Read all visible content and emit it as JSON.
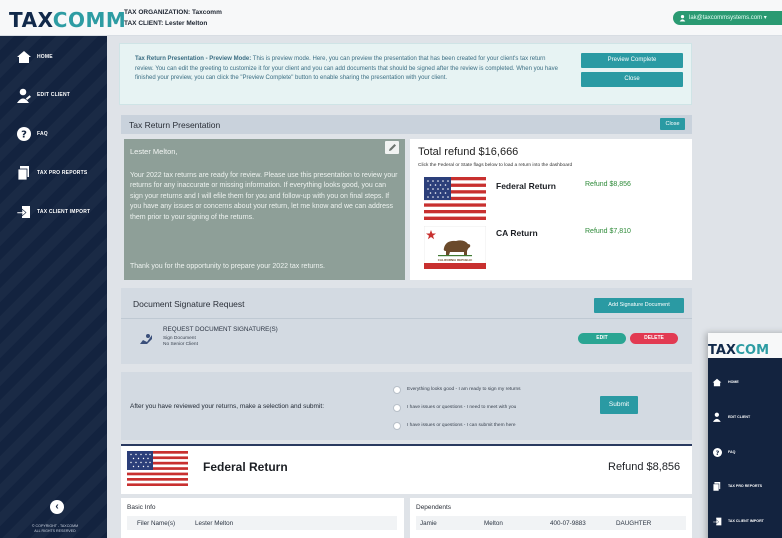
{
  "header": {
    "logo_main": "TAX",
    "logo_accent": "COMM",
    "org_line": "TAX ORGANIZATION: Taxcomm",
    "client_line": "TAX CLIENT: Lester Melton",
    "user_email": "lak@taxcommsystems.com ▾"
  },
  "sidebar": {
    "items": [
      {
        "label": "HOME",
        "icon": "home-icon"
      },
      {
        "label": "EDIT CLIENT",
        "icon": "user-edit-icon"
      },
      {
        "label": "FAQ",
        "icon": "question-icon"
      },
      {
        "label": "TAX PRO REPORTS",
        "icon": "report-icon"
      },
      {
        "label": "TAX CLIENT IMPORT",
        "icon": "import-icon"
      }
    ],
    "copyright_1": "© COPYRIGHT - TAXCOMM",
    "copyright_2": "ALL RIGHTS RESERVED"
  },
  "notice": {
    "bold": "Tax Return Presentation - Preview Mode:",
    "text": " This is preview mode. Here, you can preview the presentation that has been created for your client's tax return review. You can edit the greeting to customize it for your client and you can add documents that should be signed after the review is completed. When you have finished your preview, you can click the \"Preview Complete\" button to enable sharing the presentation with your client.",
    "preview_complete": "Preview Complete",
    "close": "Close"
  },
  "presentation": {
    "title": "Tax Return Presentation",
    "close": "Close"
  },
  "greeting": {
    "name": "Lester Melton,",
    "body": "Your 2022 tax returns are ready for review. Please use this presentation to review your returns for any inaccurate or missing information. If everything looks good, you can sign your returns and I will efile them for you and follow-up with you on final steps. If you have any issues or concerns about your return, let me know and we can address them prior to your signing of the returns.",
    "thanks": "Thank you for the opportunity to prepare your 2022 tax returns."
  },
  "refunds": {
    "total": "Total refund $16,666",
    "hint": "Click the Federal or State flags below to load a return into the dashboard",
    "federal_label": "Federal Return",
    "federal_amount": "Refund $8,856",
    "state_label": "CA Return",
    "state_amount": "Refund $7,810",
    "ca_flag_text": "CALIFORNIA REPUBLIC"
  },
  "documents": {
    "title": "Document Signature Request",
    "add_button": "Add Signature Document",
    "request_title": "REQUEST DOCUMENT SIGNATURE(S)",
    "sub1": "Sign Document",
    "sub2": "No Senior Client",
    "edit": "EDIT",
    "delete": "DELETE"
  },
  "review": {
    "prompt": "After you have reviewed your returns, make a selection and submit:",
    "options": [
      "Everything looks good - I am ready to sign my returns",
      "I have issues or questions - I need to meet with you",
      "I have issues or questions - I can submit them here"
    ],
    "submit": "Submit"
  },
  "federal": {
    "title": "Federal Return",
    "refund": "Refund $8,856"
  },
  "basic_info": {
    "title": "Basic Info",
    "label": "Filer Name(s)",
    "value": "Lester Melton"
  },
  "dependents": {
    "title": "Dependents",
    "first": "Jamie",
    "last": "Melton",
    "ssn": "400-07-9883",
    "relation": "DAUGHTER"
  },
  "window2": {
    "logo_main": "TAX",
    "logo_accent": "COM",
    "items": [
      "HOME",
      "EDIT CLIENT",
      "FAQ",
      "TAX PRO REPORTS",
      "TAX CLIENT IMPORT"
    ]
  },
  "colors": {
    "navy": "#13233f",
    "teal": "#2a9aa3",
    "green": "#2d8a38",
    "red": "#e23a52"
  }
}
